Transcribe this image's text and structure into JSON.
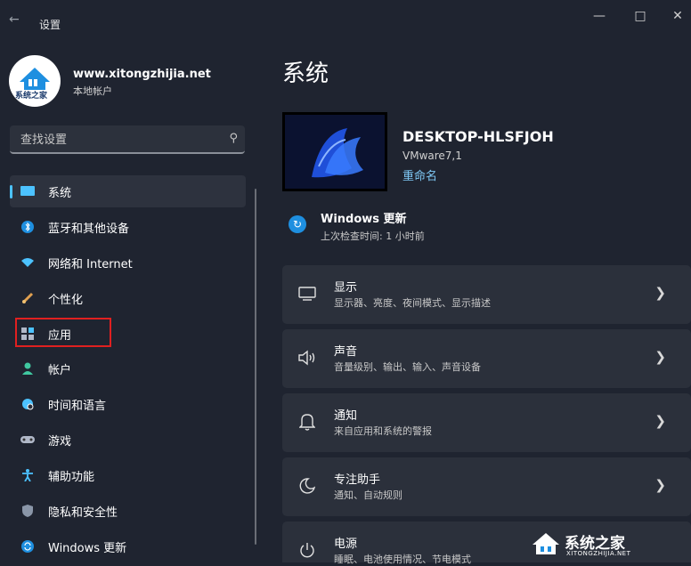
{
  "titlebar": {
    "back_icon": "back-arrow-icon",
    "app_title": "设置"
  },
  "account": {
    "name": "www.xitongzhijia.net",
    "type": "本地帐户",
    "avatar_text": "系统之家"
  },
  "search": {
    "placeholder": "查找设置"
  },
  "nav": {
    "items": [
      {
        "label": "系统",
        "icon": "monitor-icon",
        "selected": true
      },
      {
        "label": "蓝牙和其他设备",
        "icon": "bluetooth-icon"
      },
      {
        "label": "网络和 Internet",
        "icon": "wifi-icon"
      },
      {
        "label": "个性化",
        "icon": "brush-icon"
      },
      {
        "label": "应用",
        "icon": "apps-icon",
        "highlighted": true
      },
      {
        "label": "帐户",
        "icon": "person-icon"
      },
      {
        "label": "时间和语言",
        "icon": "globe-clock-icon"
      },
      {
        "label": "游戏",
        "icon": "gamepad-icon"
      },
      {
        "label": "辅助功能",
        "icon": "accessibility-icon"
      },
      {
        "label": "隐私和安全性",
        "icon": "shield-icon"
      },
      {
        "label": "Windows 更新",
        "icon": "sync-icon"
      }
    ]
  },
  "main": {
    "title": "系统",
    "device": {
      "name": "DESKTOP-HLSFJOH",
      "model": "VMware7,1",
      "rename": "重命名"
    },
    "windows_update": {
      "title": "Windows 更新",
      "subtitle": "上次检查时间: 1 小时前"
    },
    "cards": [
      {
        "title": "显示",
        "subtitle": "显示器、亮度、夜间模式、显示描述",
        "icon": "display-icon"
      },
      {
        "title": "声音",
        "subtitle": "音量级别、输出、输入、声音设备",
        "icon": "speaker-icon"
      },
      {
        "title": "通知",
        "subtitle": "来自应用和系统的警报",
        "icon": "bell-icon"
      },
      {
        "title": "专注助手",
        "subtitle": "通知、自动规则",
        "icon": "moon-icon"
      },
      {
        "title": "电源",
        "subtitle": "睡眠、电池使用情况、节电模式",
        "icon": "power-icon"
      }
    ]
  },
  "watermark": {
    "text": "系统之家",
    "url": "XITONGZHIJIA.NET"
  },
  "colors": {
    "background": "#1f2430",
    "card": "#2b303b",
    "accent": "#4cc2ff",
    "highlight_box": "#e02020",
    "link": "#7fc8f5"
  }
}
